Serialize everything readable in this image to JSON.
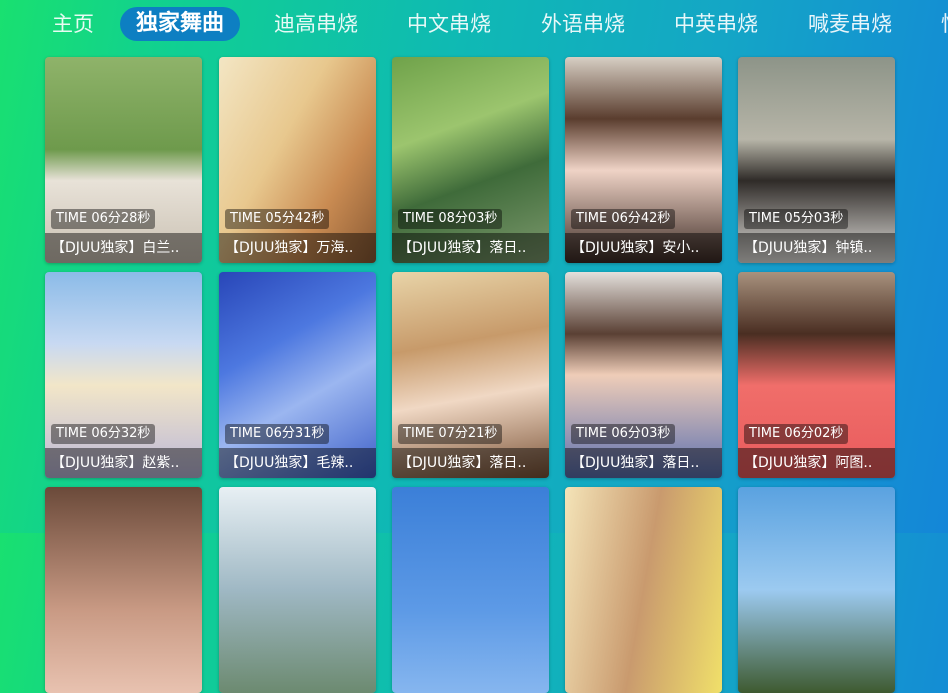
{
  "tabs": [
    {
      "label": "主页"
    },
    {
      "label": "独家舞曲",
      "active": true
    },
    {
      "label": "迪高串烧"
    },
    {
      "label": "中文串烧"
    },
    {
      "label": "外语串烧"
    },
    {
      "label": "中英串烧"
    },
    {
      "label": "喊麦串烧"
    },
    {
      "label": "性"
    }
  ],
  "videos": [
    {
      "duration": "TIME 06分28秒",
      "title": "【DJUU独家】白兰.."
    },
    {
      "duration": "TIME 05分42秒",
      "title": "【DJUU独家】万海.."
    },
    {
      "duration": "TIME 08分03秒",
      "title": "【DJUU独家】落日.."
    },
    {
      "duration": "TIME 06分42秒",
      "title": "【DJUU独家】安小.."
    },
    {
      "duration": "TIME 05分03秒",
      "title": "【DJUU独家】钟镇.."
    },
    {
      "duration": "TIME 06分32秒",
      "title": "【DJUU独家】赵紫.."
    },
    {
      "duration": "TIME 06分31秒",
      "title": "【DJUU独家】毛辣.."
    },
    {
      "duration": "TIME 07分21秒",
      "title": "【DJUU独家】落日.."
    },
    {
      "duration": "TIME 06分03秒",
      "title": "【DJUU独家】落日.."
    },
    {
      "duration": "TIME 06分02秒",
      "title": "【DJUU独家】阿图.."
    },
    {},
    {},
    {},
    {},
    {}
  ],
  "colors": {
    "active_tab_bg": "#0d7fc2",
    "caption_overlay": "rgba(0,0,0,0.45)"
  }
}
